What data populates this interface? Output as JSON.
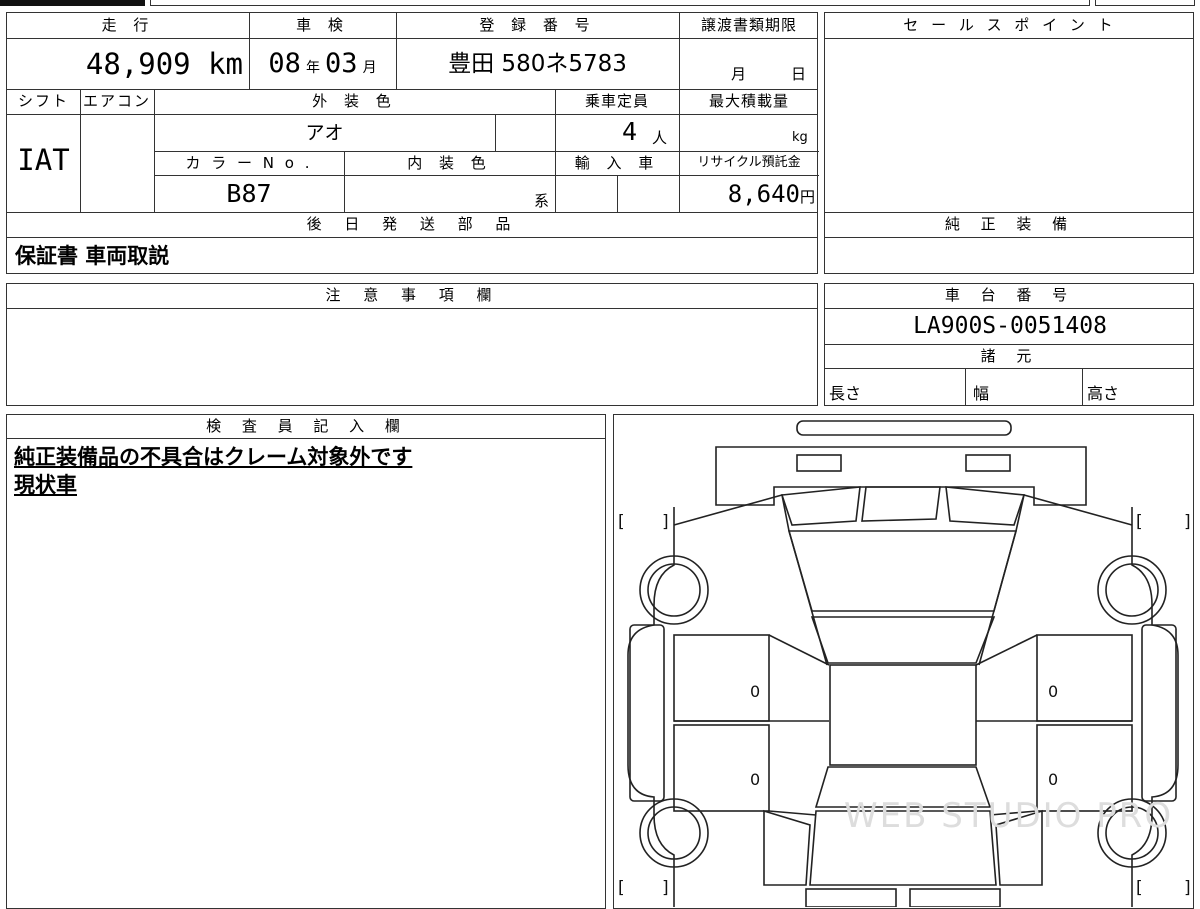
{
  "top_table": {
    "mileage_label": "走 行",
    "mileage_value": "48,909 km",
    "inspection_label": "車 検",
    "inspection_year": "08",
    "inspection_year_unit": "年",
    "inspection_month": "03",
    "inspection_month_unit": "月",
    "registration_label": "登 録 番 号",
    "registration_value": "豊田 580ネ5783",
    "transfer_docs_label": "譲渡書類期限",
    "transfer_month_unit": "月",
    "transfer_day_unit": "日",
    "shift_label": "シフト",
    "shift_value": "IAT",
    "aircon_label": "エアコン",
    "exterior_color_label": "外 装 色",
    "exterior_color_value": "アオ",
    "capacity_label": "乗車定員",
    "capacity_value": "4",
    "capacity_unit": "人",
    "max_load_label": "最大積載量",
    "max_load_unit": "kg",
    "color_no_label": "カ ラ ー N o .",
    "color_no_value": "B87",
    "interior_color_label": "内 装 色",
    "interior_color_unit": "系",
    "import_label": "輸 入 車",
    "recycle_label": "リサイクル預託金",
    "recycle_value": "8,640",
    "recycle_unit": "円",
    "later_parts_label": "後 日 発 送 部 品",
    "later_parts_value": "保証書 車両取説"
  },
  "right_panel": {
    "sales_point_label": "セ ー ル ス ポ イ ン ト",
    "genuine_equipment_label": "純 正 装 備",
    "chassis_label": "車 台 番 号",
    "chassis_value": "LA900S-0051408",
    "specs_label": "諸 元",
    "length_label": "長さ",
    "width_label": "幅",
    "height_label": "高さ"
  },
  "notes": {
    "label": "注 意 事 項 欄"
  },
  "inspector": {
    "label": "検 査 員 記 入 欄",
    "line1": "純正装備品の不具合はクレーム対象外です",
    "line2": "現状車"
  },
  "diagram": {
    "tire_left_front": "0",
    "tire_left_rear": "0",
    "tire_right_front": "0",
    "tire_right_rear": "0",
    "bracket_open": "[",
    "bracket_close": "]",
    "watermark": "WEB STUDIO PRO"
  }
}
